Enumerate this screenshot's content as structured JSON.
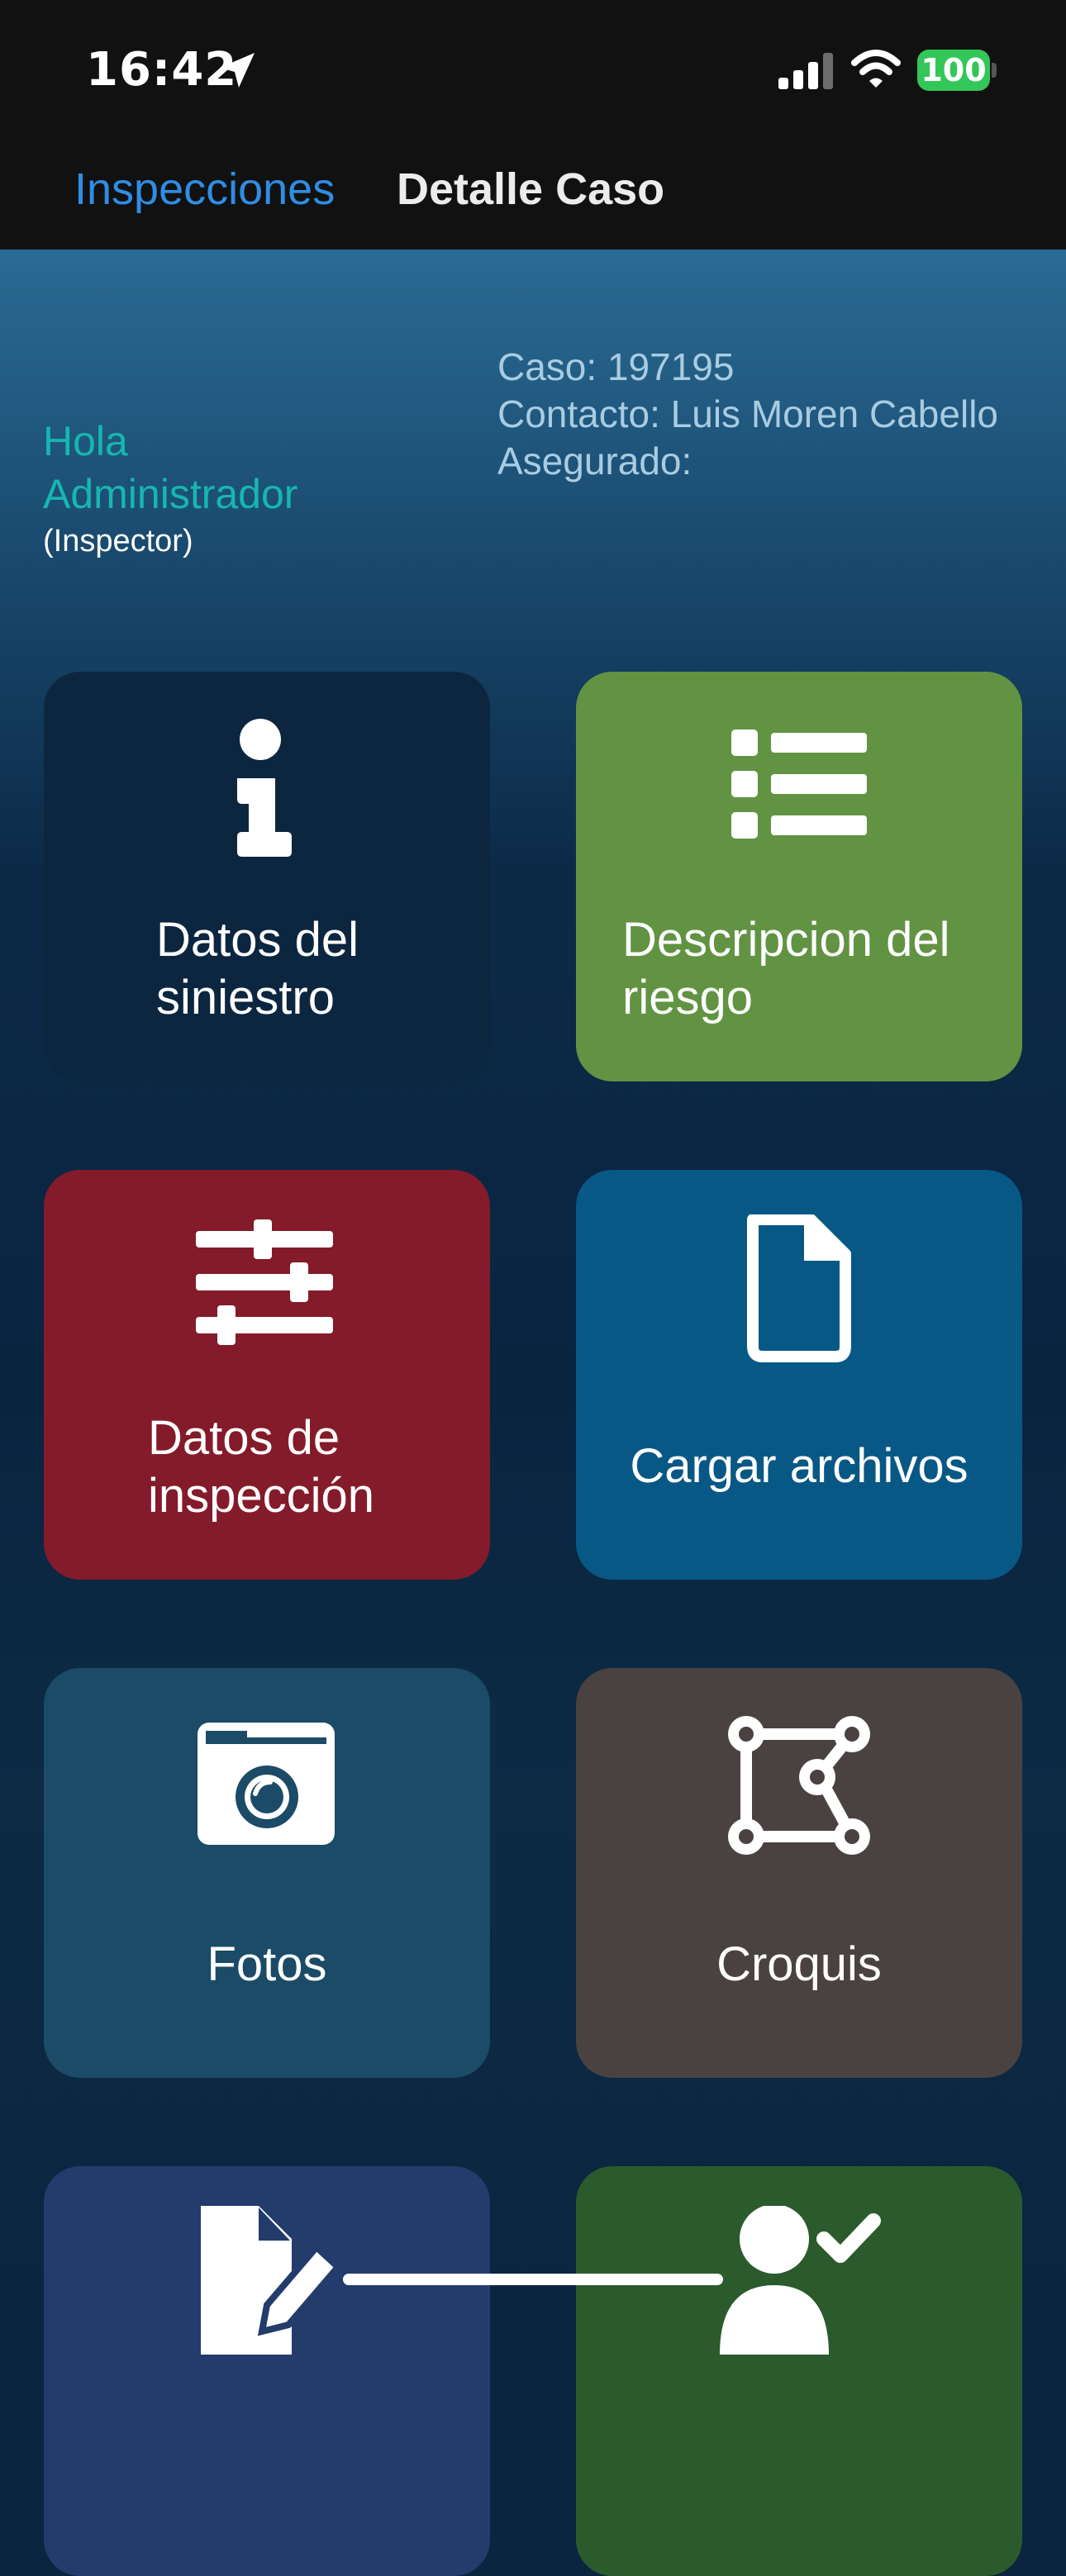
{
  "status": {
    "time": "16:42",
    "battery": "100",
    "icons": [
      "location-arrow-icon",
      "signal-icon",
      "wifi-icon",
      "battery-icon"
    ]
  },
  "nav": {
    "back_label": "Inspecciones",
    "title": "Detalle Caso"
  },
  "greeting": {
    "line1": "Hola",
    "line2": "Administrador",
    "role": "(Inspector)"
  },
  "case": {
    "caso": "Caso: 197195",
    "contacto": "Contacto: Luis Moren Cabello",
    "asegurado": "Asegurado:"
  },
  "tiles": [
    {
      "label": "Datos del siniestro",
      "icon": "info-icon",
      "color": "#0d2640"
    },
    {
      "label": "Descripcion del riesgo",
      "icon": "list-icon",
      "color": "#619343"
    },
    {
      "label": "Datos de inspección",
      "icon": "sliders-icon",
      "color": "#841b2a"
    },
    {
      "label": "Cargar archivos",
      "icon": "file-icon",
      "color": "#085886"
    },
    {
      "label": "Fotos",
      "icon": "camera-icon",
      "color": "#1b4b66"
    },
    {
      "label": "Croquis",
      "icon": "vector-shape-icon",
      "color": "#4a4241"
    },
    {
      "label": "",
      "icon": "file-signature-icon",
      "color": "#233c6b"
    },
    {
      "label": "",
      "icon": "user-check-icon",
      "color": "#2b5b2d"
    }
  ],
  "colors": {
    "accent_blue": "#2f8de4",
    "greeting_teal": "#17b6b0",
    "case_text": "#a9cce2"
  }
}
